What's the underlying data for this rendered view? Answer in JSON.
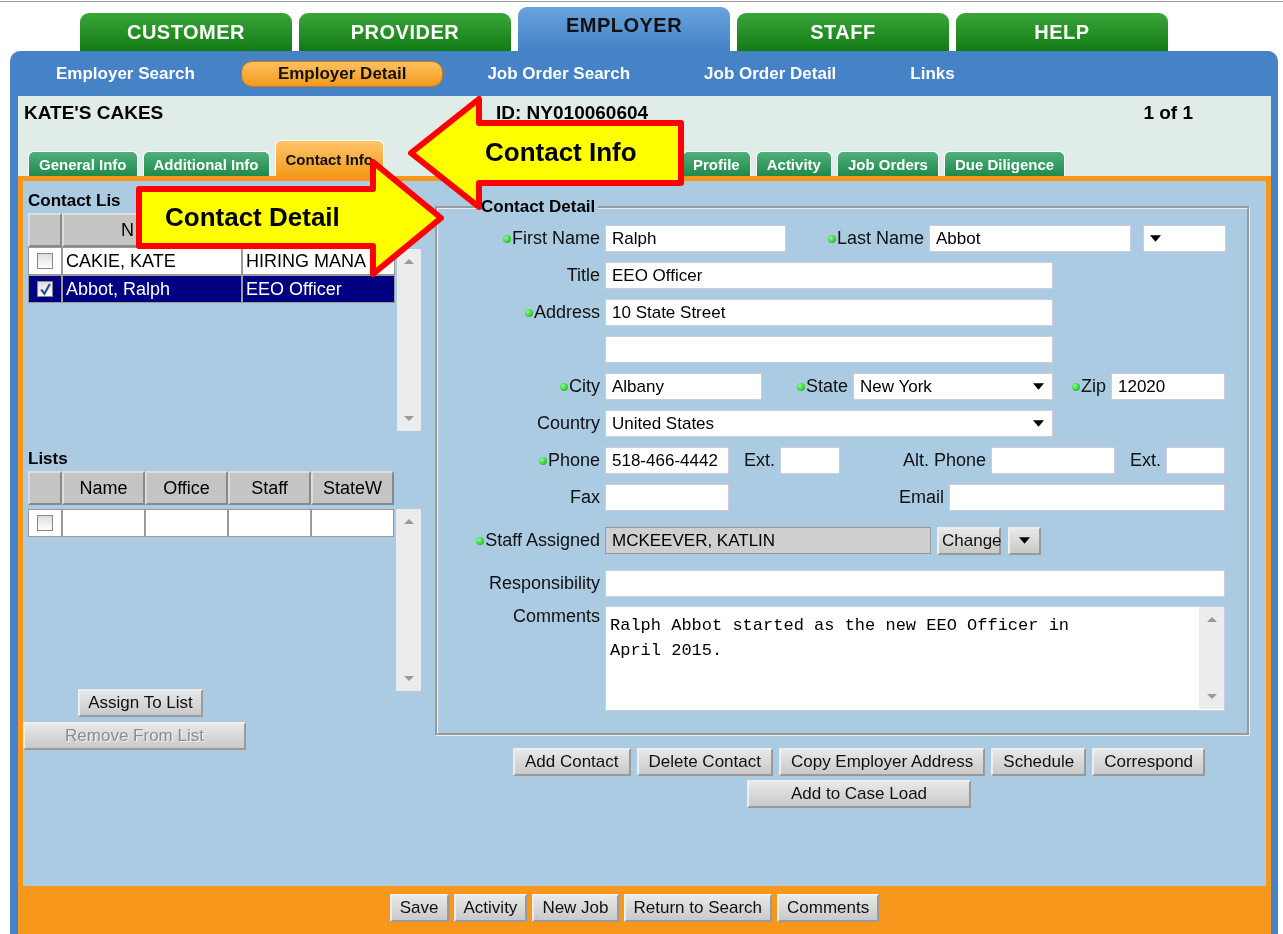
{
  "main_tabs": [
    {
      "label": "CUSTOMER",
      "selected": false
    },
    {
      "label": "PROVIDER",
      "selected": false
    },
    {
      "label": "EMPLOYER",
      "selected": true
    },
    {
      "label": "STAFF",
      "selected": false
    },
    {
      "label": "HELP",
      "selected": false
    }
  ],
  "sub_nav": [
    {
      "label": "Employer Search",
      "selected": false
    },
    {
      "label": "Employer Detail",
      "selected": true
    },
    {
      "label": "Job Order Search",
      "selected": false
    },
    {
      "label": "Job Order Detail",
      "selected": false
    },
    {
      "label": "Links",
      "selected": false
    }
  ],
  "header": {
    "employer_name": "KATE'S CAKES",
    "employer_id": "ID: NY010060604",
    "record_count": "1 of 1"
  },
  "section_tabs": [
    {
      "label": "General Info",
      "selected": false
    },
    {
      "label": "Additional Info",
      "selected": false
    },
    {
      "label": "Contact Info",
      "selected": true
    },
    {
      "label": "Profile",
      "selected": false
    },
    {
      "label": "Activity",
      "selected": false
    },
    {
      "label": "Job Orders",
      "selected": false
    },
    {
      "label": "Due Diligence",
      "selected": false
    }
  ],
  "contact_list": {
    "title": "Contact Lis",
    "columns": [
      "N"
    ],
    "rows": [
      {
        "checked": false,
        "selected": false,
        "cells": [
          "CAKIE, KATE",
          "HIRING MANA"
        ]
      },
      {
        "checked": true,
        "selected": true,
        "cells": [
          "Abbot, Ralph",
          "EEO Officer"
        ]
      }
    ]
  },
  "lists": {
    "title": "Lists",
    "columns": [
      "Name",
      "Office",
      "Staff",
      "StateW"
    ],
    "rows": [
      {
        "checked": false,
        "selected": false
      }
    ]
  },
  "list_buttons": [
    {
      "label": "Assign To List",
      "disabled": false
    },
    {
      "label": "Remove From List",
      "disabled": true
    }
  ],
  "contact_detail": {
    "title": "Contact Detail",
    "lines": [
      {
        "fields": [
          {
            "kind": "text",
            "label": "First Name",
            "required": true,
            "value": "Ralph"
          },
          {
            "kind": "text",
            "label": "Last Name",
            "required": true,
            "value": "Abbot"
          },
          {
            "kind": "select"
          }
        ]
      },
      {
        "fields": [
          {
            "kind": "text",
            "label": "Title",
            "required": false,
            "value": "EEO Officer"
          }
        ]
      },
      {
        "fields": [
          {
            "kind": "text",
            "label": "Address",
            "required": true,
            "value": "10 State Street"
          }
        ]
      },
      {
        "fields": [
          {
            "kind": "text"
          }
        ]
      },
      {
        "fields": [
          {
            "kind": "text",
            "label": "City",
            "required": true,
            "value": "Albany"
          },
          {
            "kind": "select",
            "label": "State",
            "required": true,
            "value": "New York"
          },
          {
            "kind": "text",
            "label": "Zip",
            "required": true,
            "value": "12020"
          }
        ]
      },
      {
        "fields": [
          {
            "kind": "select",
            "label": "Country",
            "required": false,
            "value": "United States"
          }
        ]
      },
      {
        "fields": [
          {
            "kind": "text",
            "label": "Phone",
            "required": true,
            "value": "518-466-4442"
          },
          {
            "kind": "text",
            "label": "Ext.",
            "required": false
          },
          {
            "kind": "text",
            "label": "Alt. Phone",
            "required": false
          },
          {
            "kind": "text",
            "label": "Ext.",
            "required": false
          }
        ]
      },
      {
        "fields": [
          {
            "kind": "text",
            "label": "Fax",
            "required": false
          },
          {
            "kind": "text",
            "label": "Email",
            "required": false
          }
        ]
      },
      {
        "fields": [
          {
            "kind": "readonly",
            "label": "Staff Assigned",
            "required": true,
            "value": "MCKEEVER, KATLIN"
          },
          {
            "kind": "button",
            "value": "Change"
          },
          {
            "kind": "dropdown-button"
          }
        ]
      },
      {
        "fields": [
          {
            "kind": "text",
            "label": "Responsibility",
            "required": false
          }
        ]
      },
      {
        "fields": [
          {
            "kind": "textarea",
            "label": "Comments",
            "required": false,
            "value": "Ralph Abbot started as the new EEO Officer in April 2015."
          }
        ]
      }
    ]
  },
  "detail_buttons": [
    [
      {
        "label": "Add Contact"
      },
      {
        "label": "Delete Contact"
      },
      {
        "label": "Copy Employer Address"
      },
      {
        "label": "Schedule"
      },
      {
        "label": "Correspond"
      }
    ],
    [
      {
        "label": "Add to Case Load"
      }
    ]
  ],
  "footer_buttons": [
    {
      "label": "Save"
    },
    {
      "label": "Activity"
    },
    {
      "label": "New Job"
    },
    {
      "label": "Return to Search"
    },
    {
      "label": "Comments"
    }
  ],
  "callouts": [
    {
      "text": "Contact Info",
      "kind": "left-arrow"
    },
    {
      "text": "Contact Detail",
      "kind": "right-arrow"
    }
  ]
}
